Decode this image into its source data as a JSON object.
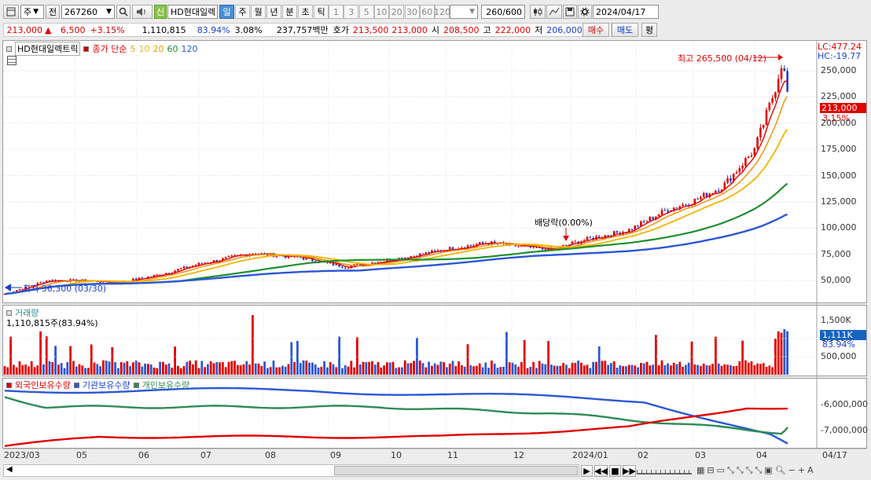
{
  "toolbar": {
    "period_unit": "주",
    "prev_label": "전",
    "code": "267260",
    "new_badge": "신",
    "stock_name": "HD현대일렉",
    "period_tabs": [
      "일",
      "주",
      "월",
      "년",
      "분",
      "초",
      "틱"
    ],
    "active_tab": "일",
    "intervals": [
      "1",
      "3",
      "5",
      "10",
      "20",
      "30",
      "60",
      "120"
    ],
    "count": "260",
    "count_total": "/600",
    "date": "2024/04/17"
  },
  "quote": {
    "price": "213,000",
    "change": "6,500",
    "change_pct": "+3.15%",
    "volume": "1,110,815",
    "volume_ratio": "83.94%",
    "turnover_pct": "3.08%",
    "trade_value": "237,757백만",
    "ask_label": "호가",
    "ask1": "213,500",
    "ask2": "213,000",
    "open_label": "시",
    "open": "208,500",
    "high_label": "고",
    "high": "222,000",
    "low_label": "저",
    "low": "206,000",
    "buy_label": "매수",
    "sell_label": "매도",
    "eval_label": "평"
  },
  "price_panel": {
    "stock_label": "HD현대일렉트릭",
    "ma_title": "종가 단순",
    "ma_periods": [
      {
        "label": "5",
        "color": "#e8a317"
      },
      {
        "label": "10",
        "color": "#f2b400"
      },
      {
        "label": "20",
        "color": "#e6a000"
      },
      {
        "label": "60",
        "color": "#1f8f2f"
      },
      {
        "label": "120",
        "color": "#2b57d6"
      }
    ],
    "lc": "LC:477.24",
    "hc": "HC:-19.77",
    "high_note": "최고 265,500 (04/12)",
    "low_note": "최저 36,300 (03/30)",
    "dividend_note": "배당락(0.00%)",
    "price_tag": "213,000",
    "pct_tag": "3.15%",
    "y_ticks": [
      "250,000",
      "225,000",
      "200,000",
      "175,000",
      "150,000",
      "125,000",
      "100,000",
      "75,000",
      "50,000"
    ]
  },
  "volume_panel": {
    "title": "거래량",
    "value": "1,110,815주(83.94%)",
    "y_ticks": [
      "1,500K",
      "1,000K",
      "500,000"
    ],
    "tag_value": "1,111K",
    "tag_pct": "83.94%"
  },
  "holdings_panel": {
    "foreign": "외국인보유수량",
    "institution": "기관보유수량",
    "individual": "개인보유수량",
    "y_ticks": [
      "-6,000,000",
      "-7,000,000"
    ],
    "colors": {
      "foreign": "#e00000",
      "institution": "#2b57d6",
      "individual": "#2e8b57"
    }
  },
  "x_axis": {
    "labels": [
      "2023/03",
      "05",
      "06",
      "07",
      "08",
      "09",
      "10",
      "11",
      "12",
      "2024/01",
      "02",
      "03",
      "04",
      "04/17"
    ]
  },
  "chart_data": {
    "type": "line",
    "title": "HD현대일렉트릭",
    "series": [
      {
        "name": "종가",
        "x": [
          "2023/03/30",
          "2023/05",
          "2023/06",
          "2023/07",
          "2023/08",
          "2023/09",
          "2023/10",
          "2023/11",
          "2023/12",
          "2024/01",
          "2024/02",
          "2024/03",
          "2024/04/12",
          "2024/04/17"
        ],
        "values": [
          36300,
          51000,
          48000,
          66000,
          76000,
          63000,
          70000,
          80000,
          86000,
          80000,
          98000,
          132000,
          265500,
          213000
        ]
      }
    ],
    "ylim": [
      30000,
      270000
    ]
  }
}
